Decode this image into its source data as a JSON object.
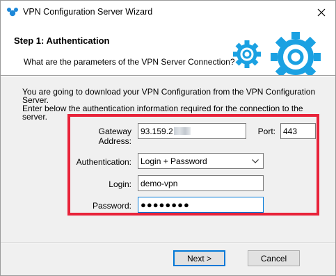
{
  "window": {
    "title": "VPN Configuration Server Wizard"
  },
  "header": {
    "step_title": "Step 1: Authentication",
    "step_subtitle": "What are the parameters of the VPN Server Connection?"
  },
  "description": {
    "line1": "You are going to download your VPN Configuration from the VPN Configuration Server.",
    "line2": "Enter below the authentication information required for the connection to the server."
  },
  "form": {
    "gateway": {
      "label": "Gateway Address:",
      "value": "93.159.2"
    },
    "port": {
      "label": "Port:",
      "value": "443"
    },
    "authentication": {
      "label": "Authentication:",
      "value": "Login + Password"
    },
    "login": {
      "label": "Login:",
      "value": "demo-vpn"
    },
    "password": {
      "label": "Password:",
      "value": "●●●●●●●●"
    }
  },
  "buttons": {
    "next": "Next >",
    "cancel": "Cancel"
  },
  "colors": {
    "accent": "#0078d7",
    "highlight": "#e8233a",
    "gear": "#1ba1e2"
  }
}
